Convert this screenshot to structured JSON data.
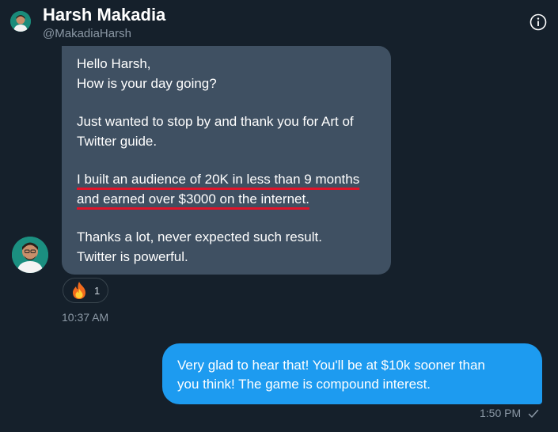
{
  "header": {
    "name": "Harsh Makadia",
    "handle": "@MakadiaHarsh",
    "info_icon": "info-icon"
  },
  "incoming_message": {
    "lines_1": [
      "Hello Harsh,",
      "How is your day going?"
    ],
    "para_2": [
      "Just wanted to stop by and thank you for Art of",
      "Twitter guide."
    ],
    "para_3": [
      "I built an audience of 20K in less than 9 months",
      "and earned over $3000 on the internet."
    ],
    "para_4": [
      "Thanks a lot, never expected such result.",
      "Twitter is powerful."
    ],
    "reaction": {
      "emoji": "fire-emoji",
      "count": "1"
    },
    "time": "10:37 AM",
    "underline_color": "#e0142a"
  },
  "outgoing_message": {
    "lines": [
      "Very glad to hear that! You'll be at $10k sooner than",
      "you think! The game is compound interest."
    ],
    "time": "1:50 PM",
    "status_icon": "read-check-icon"
  },
  "colors": {
    "background": "#15202b",
    "incoming_bubble": "#3f5062",
    "outgoing_bubble": "#1d9bf0",
    "muted_text": "#8b98a5"
  }
}
